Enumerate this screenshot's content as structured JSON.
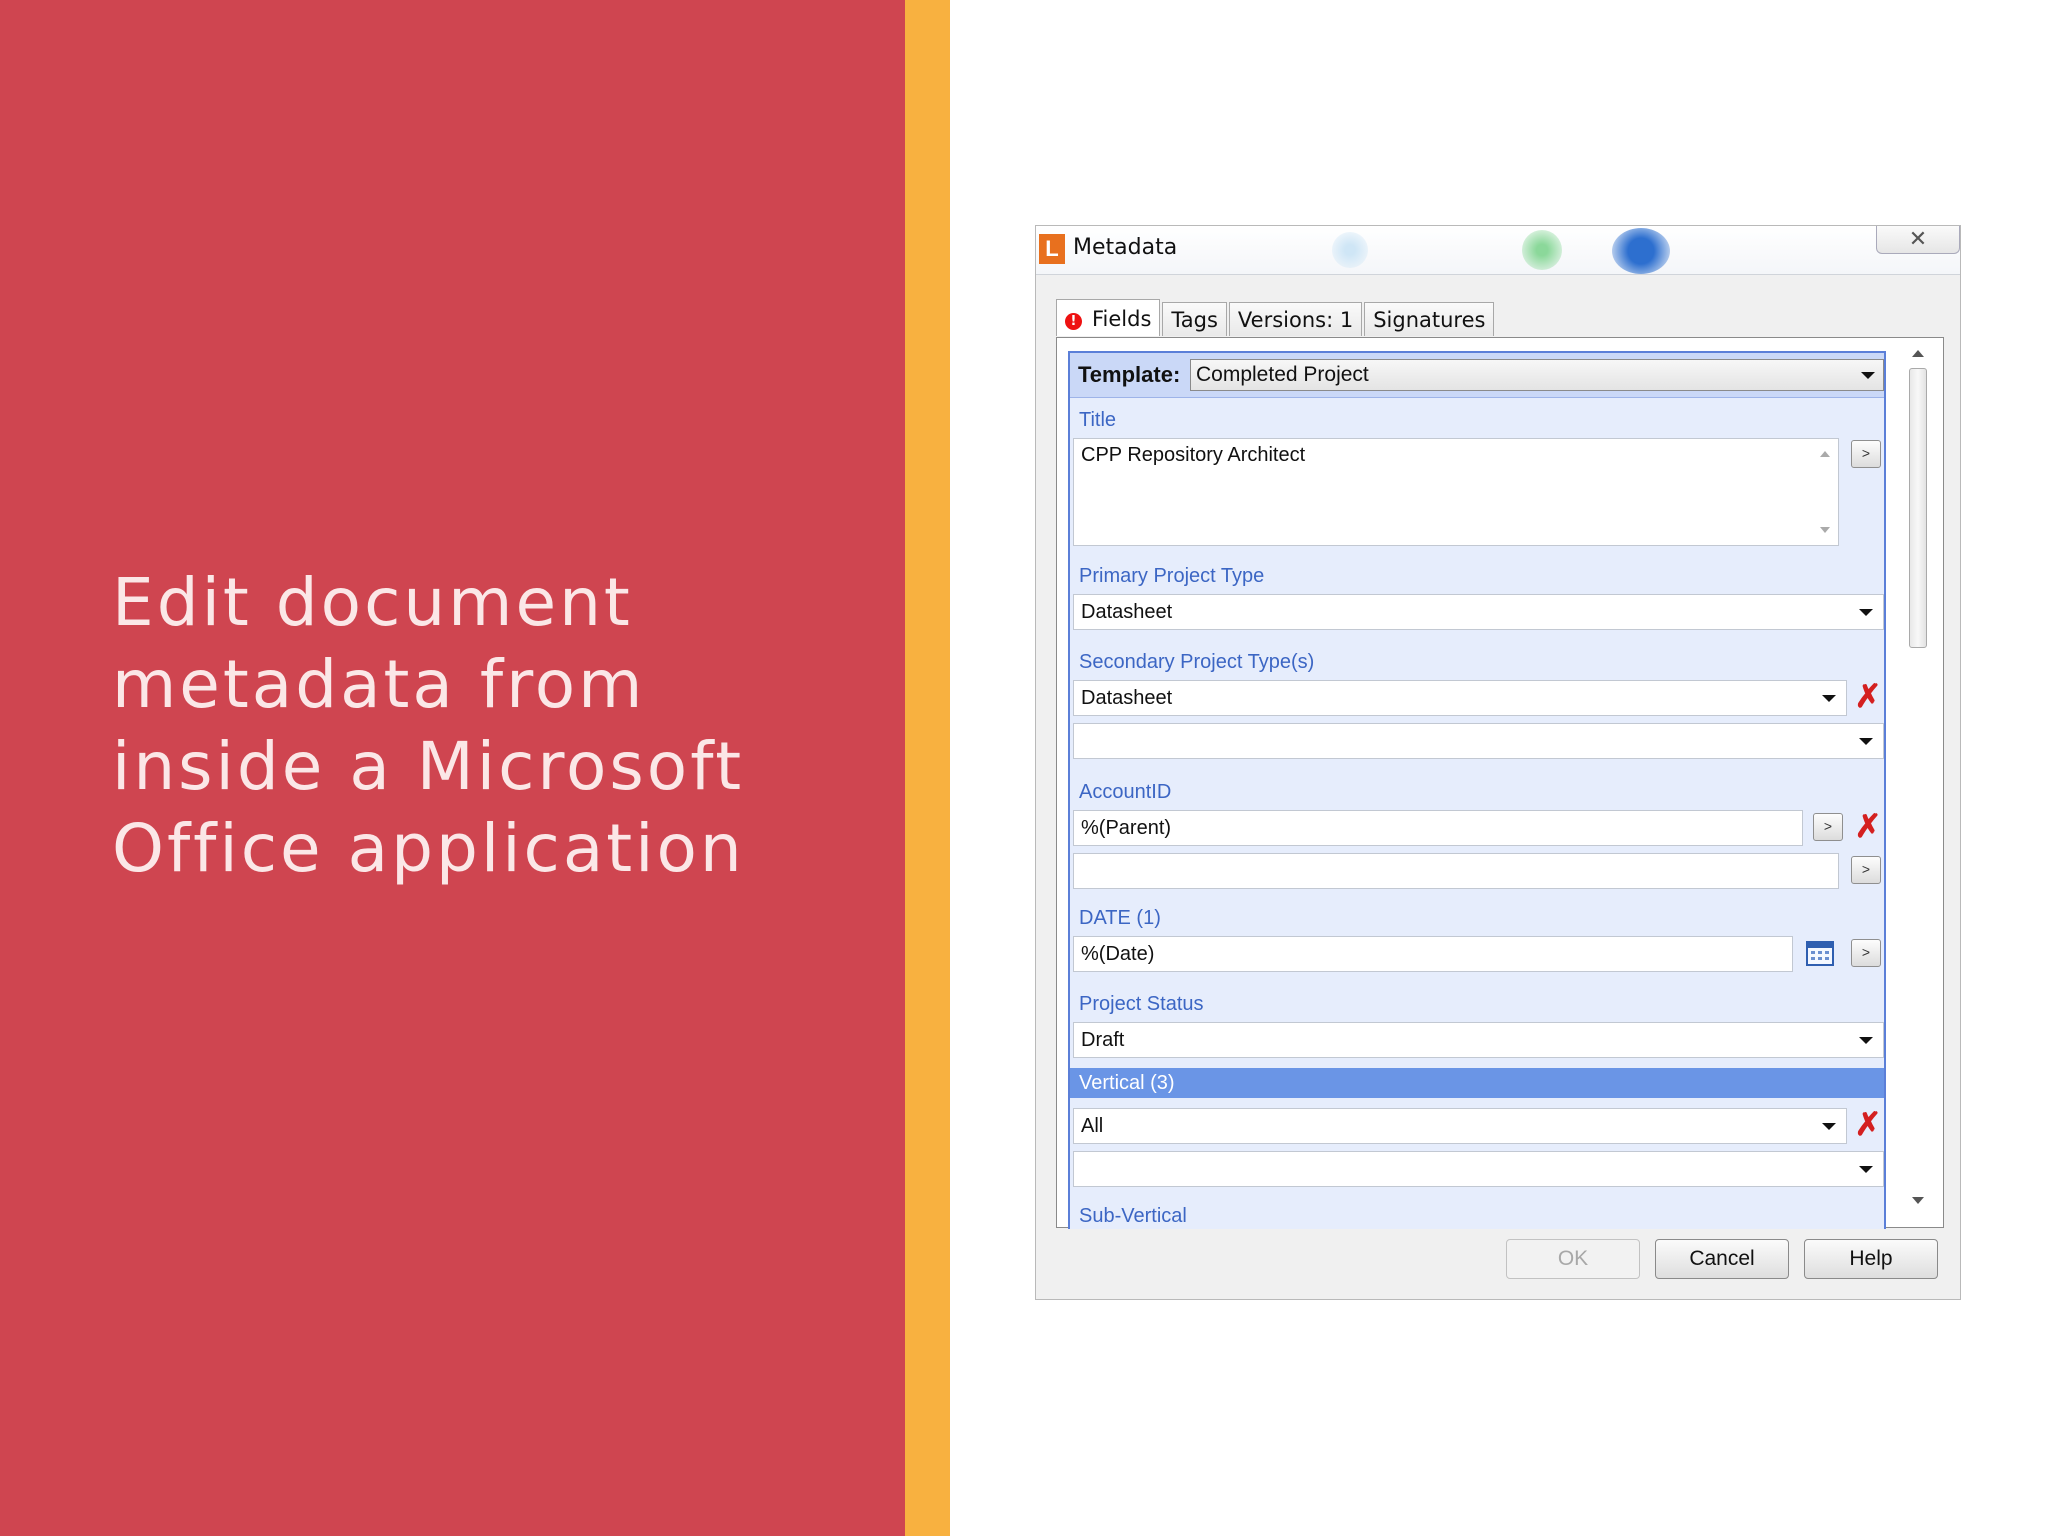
{
  "slide": {
    "headline": "Edit document metadata from inside a Microsoft Office application",
    "colors": {
      "left_panel": "#cf4550",
      "accent_stripe": "#f8b140",
      "headline_text": "#fbe7e7"
    }
  },
  "dialog": {
    "app_icon_letter": "L",
    "title": "Metadata",
    "close_glyph": "✕",
    "tabs": [
      {
        "label": "Fields",
        "active": true,
        "alert_icon": "!"
      },
      {
        "label": "Tags"
      },
      {
        "label": "Versions: 1"
      },
      {
        "label": "Signatures"
      }
    ],
    "template": {
      "label": "Template:",
      "value": "Completed Project"
    },
    "fields": {
      "title": {
        "label": "Title",
        "value": "CPP Repository Architect"
      },
      "primary_project_type": {
        "label": "Primary Project Type",
        "value": "Datasheet"
      },
      "secondary_project_types": {
        "label": "Secondary Project Type(s)",
        "values": [
          "Datasheet",
          ""
        ]
      },
      "account_id": {
        "label": "AccountID",
        "values": [
          "%(Parent)",
          ""
        ]
      },
      "date": {
        "label": "DATE (1)",
        "value": "%(Date)"
      },
      "project_status": {
        "label": "Project Status",
        "value": "Draft"
      },
      "vertical": {
        "label": "Vertical (3)",
        "values": [
          "All",
          ""
        ]
      },
      "sub_vertical": {
        "label": "Sub-Vertical"
      }
    },
    "mini_button_glyph": ">",
    "delete_glyph": "✗",
    "buttons": {
      "ok": "OK",
      "cancel": "Cancel",
      "help": "Help"
    }
  }
}
